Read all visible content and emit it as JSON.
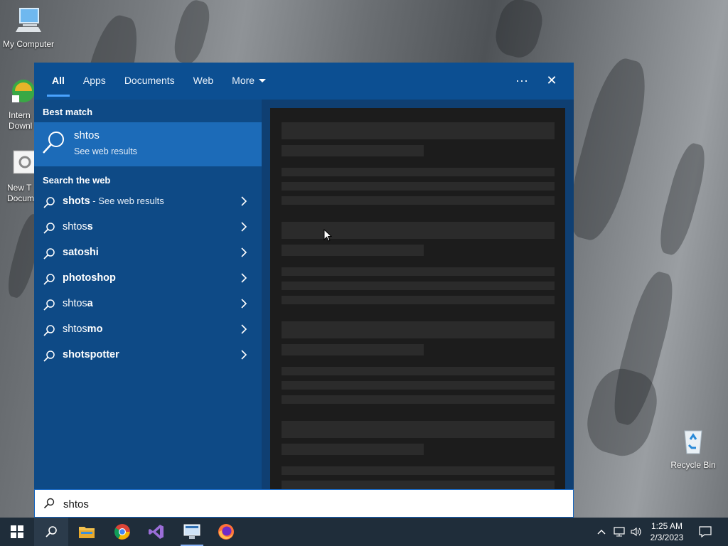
{
  "desktop": {
    "icons": [
      {
        "label": "My Computer"
      },
      {
        "label": "Intern Downl"
      },
      {
        "label": "New T Docum"
      },
      {
        "label": "Recycle Bin"
      }
    ]
  },
  "search_panel": {
    "tabs": [
      {
        "label": "All",
        "active": true
      },
      {
        "label": "Apps"
      },
      {
        "label": "Documents"
      },
      {
        "label": "Web"
      },
      {
        "label": "More"
      }
    ],
    "more_options_label": "···",
    "close_label": "✕",
    "best_match_title": "Best match",
    "best_match": {
      "title": "shtos",
      "subtitle": "See web results"
    },
    "search_web_title": "Search the web",
    "suggestions": [
      {
        "prefix": "",
        "bold": "shots",
        "suffix": " - See web results"
      },
      {
        "prefix": "shtos",
        "bold": "s",
        "suffix": ""
      },
      {
        "prefix": "",
        "bold": "satoshi",
        "suffix": ""
      },
      {
        "prefix": "",
        "bold": "photoshop",
        "suffix": ""
      },
      {
        "prefix": "shtos",
        "bold": "a",
        "suffix": ""
      },
      {
        "prefix": "shtos",
        "bold": "mo",
        "suffix": ""
      },
      {
        "prefix": "",
        "bold": "shotspotter",
        "suffix": ""
      }
    ]
  },
  "search_box": {
    "value": "shtos"
  },
  "taskbar": {
    "clock_time": "1:25 AM",
    "clock_date": "2/3/2023"
  },
  "colors": {
    "accent": "#1c6bb8",
    "panel": "#0e4a86",
    "taskbar": "#1f2d3a"
  }
}
